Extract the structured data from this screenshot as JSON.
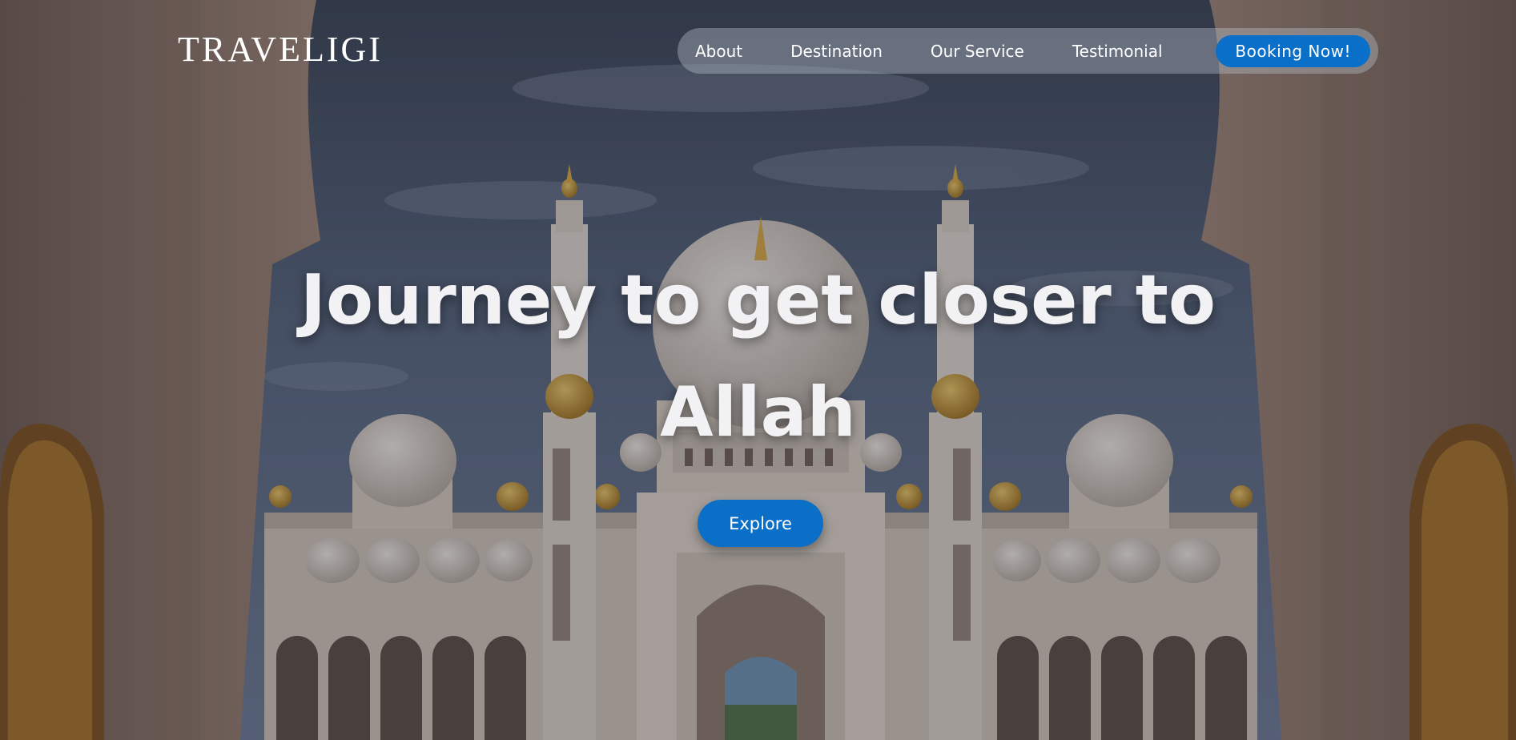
{
  "brand": {
    "logo_text": "TRAVELIGI"
  },
  "nav": {
    "items": [
      {
        "label": "About"
      },
      {
        "label": "Destination"
      },
      {
        "label": "Our Service"
      },
      {
        "label": "Testimonial"
      }
    ],
    "cta_label": "Booking Now!"
  },
  "hero": {
    "headline_line1": "Journey to get closer to",
    "headline_line2": "Allah",
    "explore_label": "Explore"
  },
  "colors": {
    "accent": "#0a6fc8",
    "sky": "#4b5567",
    "text": "#f2f2f4"
  }
}
